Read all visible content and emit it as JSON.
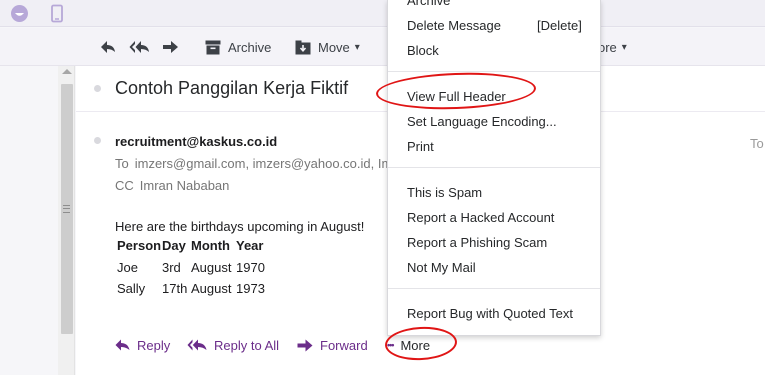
{
  "topbar": {
    "icons": [
      "smiley-icon",
      "mobile-icon"
    ]
  },
  "toolbar": {
    "archive_label": "Archive",
    "move_label": "Move",
    "more_partial_label": "ore"
  },
  "message": {
    "subject": "Contoh Panggilan Kerja Fiktif",
    "from": "recruitment@kaskus.co.id",
    "to_label": "To",
    "to_value": "imzers@gmail.com, imzers@yahoo.co.id, Im",
    "cc_label": "CC",
    "cc_value": "Imran Nababan",
    "right_to_label": "To",
    "intro": "Here are the birthdays upcoming in August!",
    "table": {
      "headers": [
        "Person",
        "Day",
        "Month",
        "Year"
      ],
      "rows": [
        [
          "Joe",
          "3rd",
          "August",
          "1970"
        ],
        [
          "Sally",
          "17th",
          "August",
          "1973"
        ]
      ]
    }
  },
  "actions": {
    "reply": "Reply",
    "reply_all": "Reply to All",
    "forward": "Forward",
    "more_dots": "•••",
    "more": "More"
  },
  "menu": {
    "archive": "Archive",
    "delete": "Delete Message",
    "delete_shortcut": "[Delete]",
    "block": "Block",
    "view_full_header": "View Full Header",
    "set_language": "Set Language Encoding...",
    "print": "Print",
    "spam": "This is Spam",
    "hacked": "Report a Hacked Account",
    "phishing": "Report a Phishing Scam",
    "not_my_mail": "Not My Mail",
    "report_bug": "Report Bug with Quoted Text"
  },
  "colors": {
    "accent_purple": "#6b2d8a",
    "annotation_red": "#e01515",
    "toolbar_bg": "#f4f3f8"
  }
}
